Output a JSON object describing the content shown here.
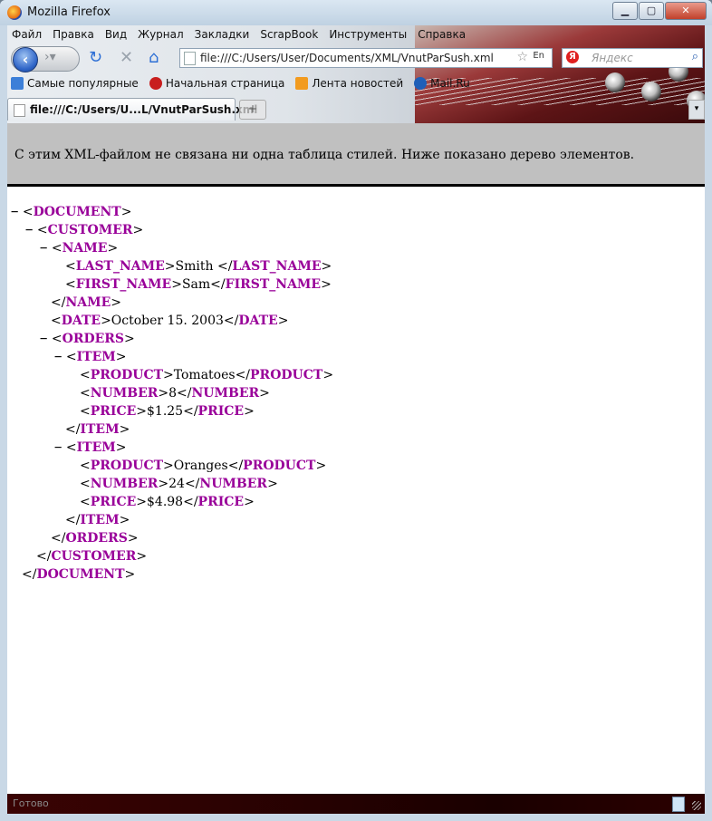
{
  "window": {
    "title": "Mozilla Firefox",
    "buttons": {
      "minimize": "▁",
      "maximize": "▢",
      "close": "✕"
    }
  },
  "menu": [
    "Файл",
    "Правка",
    "Вид",
    "Журнал",
    "Закладки",
    "ScrapBook",
    "Инструменты",
    "Справка"
  ],
  "nav": {
    "url": "file:///C:/Users/User/Documents/XML/VnutParSush.xml",
    "lang": "En",
    "search_placeholder": "Яндекс",
    "yandex_letter": "Я"
  },
  "bookmarks": [
    "Самые популярные",
    "Начальная страница",
    "Лента новостей",
    "Mail.Ru"
  ],
  "tab": {
    "label": "file:///C:/Users/U...L/VnutParSush.xml"
  },
  "page": {
    "info": "С этим XML-файлом не связана ни одна таблица стилей. Ниже показано дерево элементов."
  },
  "xml": {
    "document": "DOCUMENT",
    "customer": "CUSTOMER",
    "name": "NAME",
    "last_name_tag": "LAST_NAME",
    "last_name": "Smith ",
    "first_name_tag": "FIRST_NAME",
    "first_name": "Sam",
    "date_tag": "DATE",
    "date": "October 15. 2003",
    "orders": "ORDERS",
    "item": "ITEM",
    "product_tag": "PRODUCT",
    "number_tag": "NUMBER",
    "price_tag": "PRICE",
    "items": [
      {
        "product": "Tomatoes",
        "number": "8",
        "price": "$1.25"
      },
      {
        "product": "Oranges",
        "number": "24",
        "price": "$4.98"
      }
    ]
  },
  "status": {
    "text": "Готово"
  }
}
